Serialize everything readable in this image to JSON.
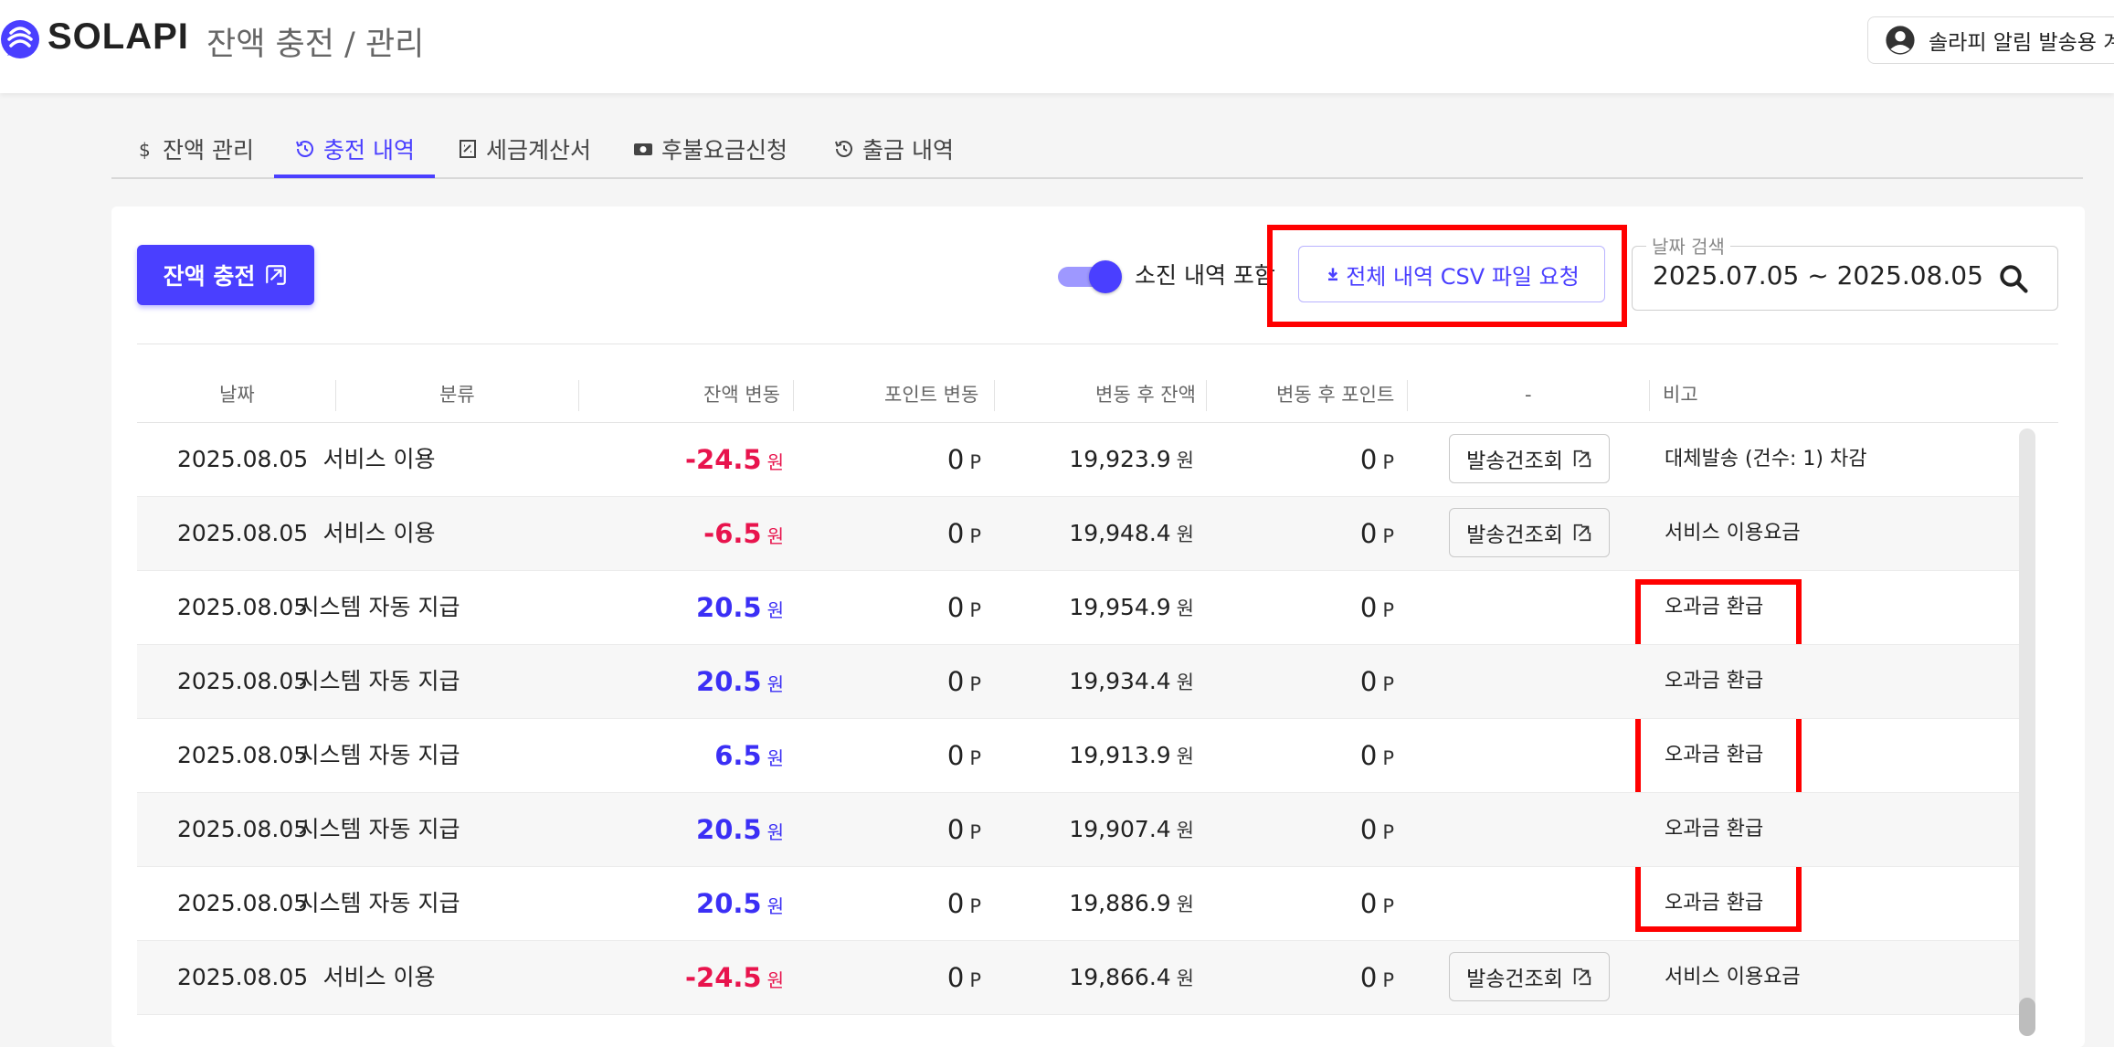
{
  "header": {
    "logo_text": "SOLAPI",
    "page_title": "잔액 충전 / 관리",
    "account_label": "솔라피 알림 발송용 계정"
  },
  "tabs": [
    {
      "label": "잔액 관리",
      "icon": "dollar-icon",
      "active": false
    },
    {
      "label": "충전 내역",
      "icon": "history-icon",
      "active": true
    },
    {
      "label": "세금계산서",
      "icon": "receipt-icon",
      "active": false
    },
    {
      "label": "후불요금신청",
      "icon": "money-icon",
      "active": false
    },
    {
      "label": "출금 내역",
      "icon": "history-icon",
      "active": false
    }
  ],
  "toolbar": {
    "charge_button": "잔액 충전",
    "include_used_label": "소진 내역 포함",
    "include_used_checked": true,
    "csv_button": "전체 내역 CSV 파일 요청",
    "date_search_label": "날짜 검색",
    "date_range": "2025.07.05 ~ 2025.08.05"
  },
  "table": {
    "columns": [
      "날짜",
      "분류",
      "잔액 변동",
      "포인트 변동",
      "변동 후 잔액",
      "변동 후 포인트",
      "-",
      "비고"
    ],
    "rows": [
      {
        "date": "2025.08.05",
        "category": "서비스 이용",
        "amount": "-24.5",
        "amount_unit": "원",
        "sign": "neg",
        "points": "0",
        "points_unit": "P",
        "balance": "19,923.9",
        "balance_unit": "원",
        "balance_points": "0",
        "balance_points_unit": "P",
        "action": "발송건조회",
        "note": "대체발송 (건수: 1) 차감"
      },
      {
        "date": "2025.08.05",
        "category": "서비스 이용",
        "amount": "-6.5",
        "amount_unit": "원",
        "sign": "neg",
        "points": "0",
        "points_unit": "P",
        "balance": "19,948.4",
        "balance_unit": "원",
        "balance_points": "0",
        "balance_points_unit": "P",
        "action": "발송건조회",
        "note": "서비스 이용요금"
      },
      {
        "date": "2025.08.05",
        "category": "시스템 자동 지급",
        "amount": "20.5",
        "amount_unit": "원",
        "sign": "pos",
        "points": "0",
        "points_unit": "P",
        "balance": "19,954.9",
        "balance_unit": "원",
        "balance_points": "0",
        "balance_points_unit": "P",
        "action": "",
        "note": "오과금 환급"
      },
      {
        "date": "2025.08.05",
        "category": "시스템 자동 지급",
        "amount": "20.5",
        "amount_unit": "원",
        "sign": "pos",
        "points": "0",
        "points_unit": "P",
        "balance": "19,934.4",
        "balance_unit": "원",
        "balance_points": "0",
        "balance_points_unit": "P",
        "action": "",
        "note": "오과금 환급"
      },
      {
        "date": "2025.08.05",
        "category": "시스템 자동 지급",
        "amount": "6.5",
        "amount_unit": "원",
        "sign": "pos",
        "points": "0",
        "points_unit": "P",
        "balance": "19,913.9",
        "balance_unit": "원",
        "balance_points": "0",
        "balance_points_unit": "P",
        "action": "",
        "note": "오과금 환급"
      },
      {
        "date": "2025.08.05",
        "category": "시스템 자동 지급",
        "amount": "20.5",
        "amount_unit": "원",
        "sign": "pos",
        "points": "0",
        "points_unit": "P",
        "balance": "19,907.4",
        "balance_unit": "원",
        "balance_points": "0",
        "balance_points_unit": "P",
        "action": "",
        "note": "오과금 환급"
      },
      {
        "date": "2025.08.05",
        "category": "시스템 자동 지급",
        "amount": "20.5",
        "amount_unit": "원",
        "sign": "pos",
        "points": "0",
        "points_unit": "P",
        "balance": "19,886.9",
        "balance_unit": "원",
        "balance_points": "0",
        "balance_points_unit": "P",
        "action": "",
        "note": "오과금 환급"
      },
      {
        "date": "2025.08.05",
        "category": "서비스 이용",
        "amount": "-24.5",
        "amount_unit": "원",
        "sign": "neg",
        "points": "0",
        "points_unit": "P",
        "balance": "19,866.4",
        "balance_unit": "원",
        "balance_points": "0",
        "balance_points_unit": "P",
        "action": "발송건조회",
        "note": "서비스 이용요금"
      }
    ]
  },
  "colors": {
    "accent": "#4a3fff",
    "negative": "#e8144d",
    "positive": "#3b2ff5",
    "highlight": "#ff0000"
  }
}
